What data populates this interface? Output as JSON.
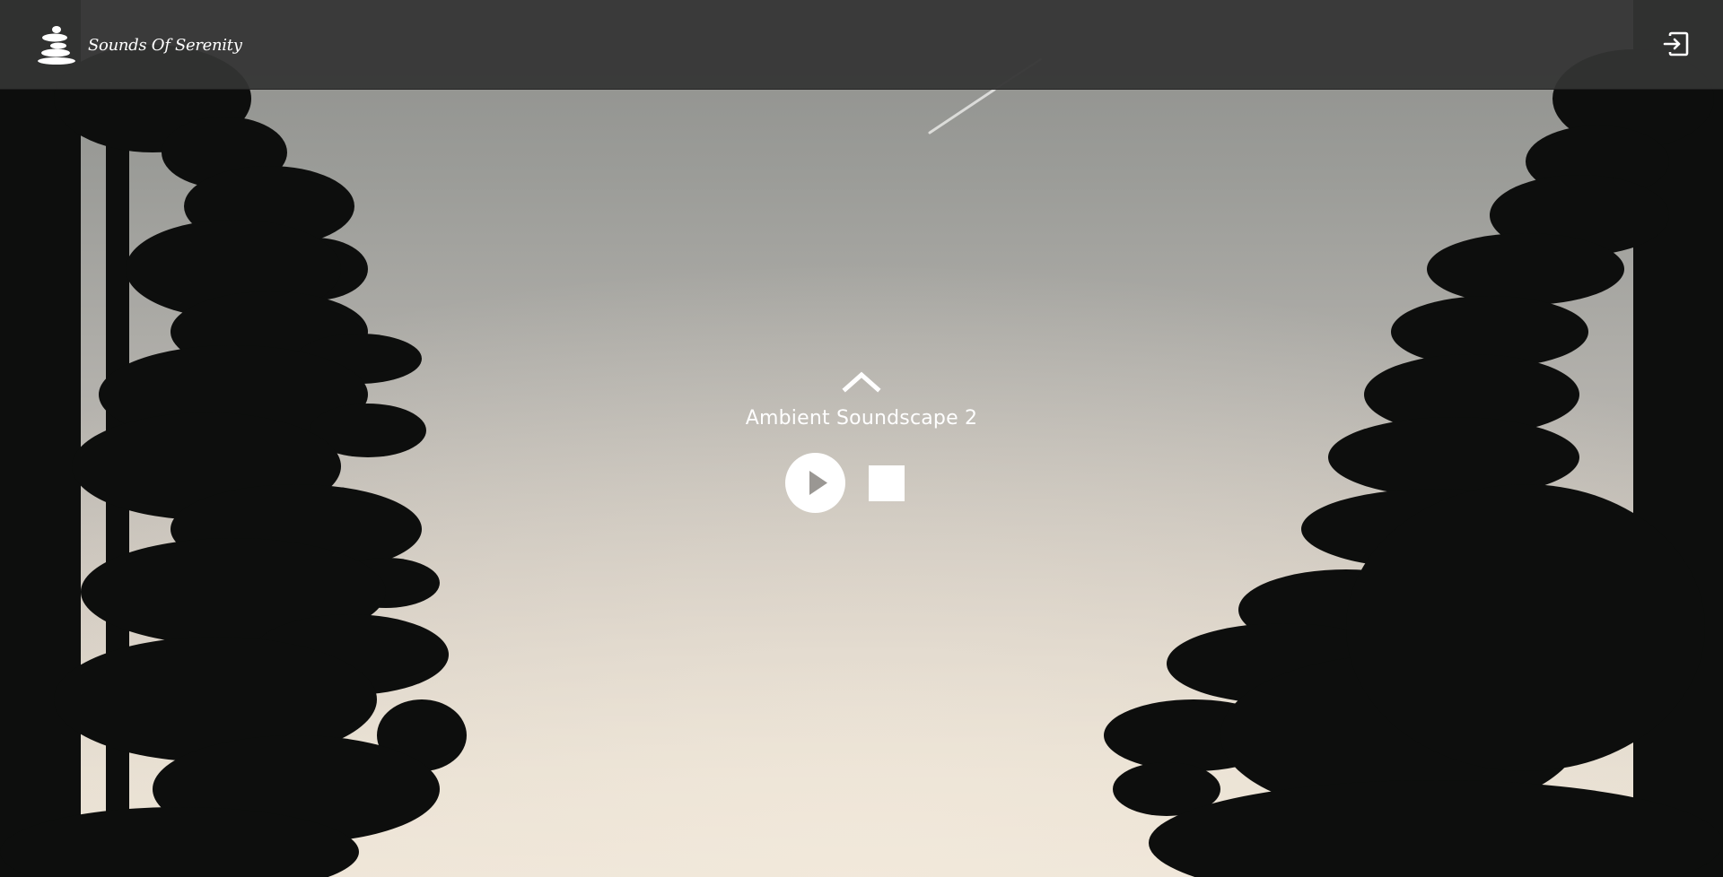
{
  "header": {
    "brand_name": "Sounds Of Serenity",
    "logo_icon": "stacked-stones-logo",
    "logout_icon": "logout-icon"
  },
  "player": {
    "expand_icon": "chevron-up-icon",
    "track_title": "Ambient Soundscape 2",
    "play_icon": "play-icon",
    "stop_icon": "stop-icon"
  },
  "colors": {
    "header_bg": "#343434",
    "text": "#ffffff",
    "sky_top": "#8e8f8c",
    "sky_bottom": "#ece3d6",
    "tree_silhouette": "#0d0e0d"
  }
}
